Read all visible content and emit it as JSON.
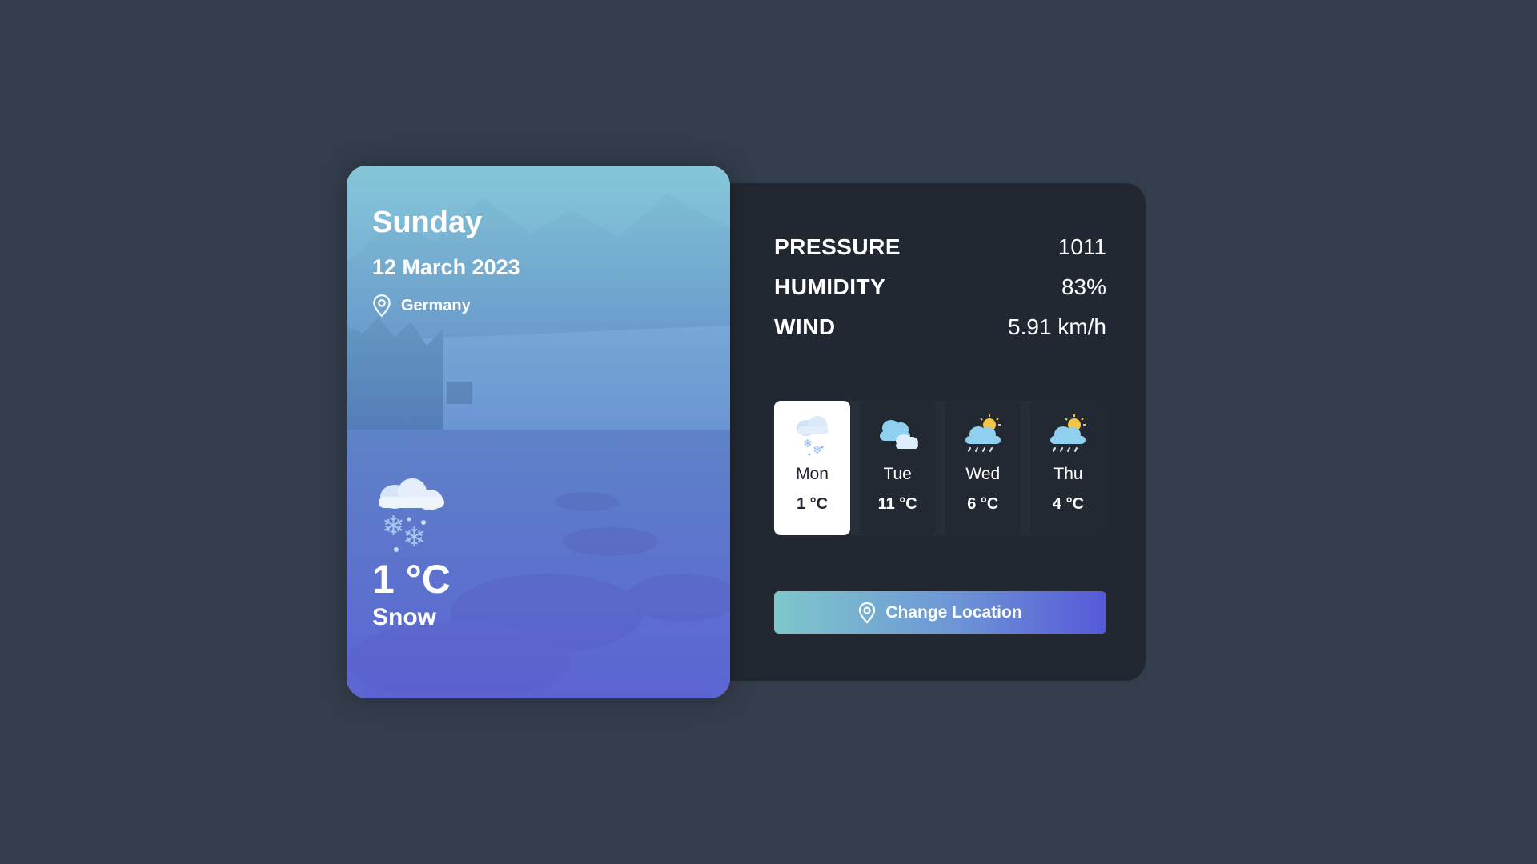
{
  "current": {
    "day": "Sunday",
    "date": "12 March 2023",
    "location": "Germany",
    "temperature": "1 °C",
    "condition": "Snow",
    "icon": "snow-cloud-icon"
  },
  "stats": [
    {
      "label": "PRESSURE",
      "value": "1011"
    },
    {
      "label": "HUMIDITY",
      "value": "83%"
    },
    {
      "label": "WIND",
      "value": "5.91 km/h"
    }
  ],
  "forecast": [
    {
      "day": "Mon",
      "temp": "1 °C",
      "icon": "snow-cloud-icon",
      "active": true
    },
    {
      "day": "Tue",
      "temp": "11 °C",
      "icon": "cloudy-icon",
      "active": false
    },
    {
      "day": "Wed",
      "temp": "6 °C",
      "icon": "sun-rain-icon",
      "active": false
    },
    {
      "day": "Thu",
      "temp": "4 °C",
      "icon": "sun-rain-icon",
      "active": false
    }
  ],
  "button": {
    "label": "Change Location",
    "icon": "map-pin-icon"
  },
  "colors": {
    "page_bg": "#343d4c",
    "panel_bg": "#222831",
    "accent_start": "#7ec8cb",
    "accent_end": "#5658d8"
  }
}
